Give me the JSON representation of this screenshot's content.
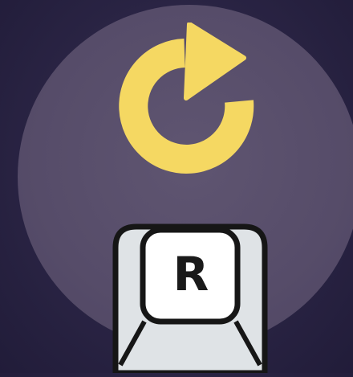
{
  "icon": {
    "name": "reload-icon",
    "color": "#f5d862"
  },
  "key": {
    "label": "R",
    "face_color": "#ffffff",
    "side_color": "#dfe3e6",
    "outline_color": "#161616"
  },
  "background": {
    "base_color": "#2a2444",
    "halo_color": "#5b5170"
  }
}
